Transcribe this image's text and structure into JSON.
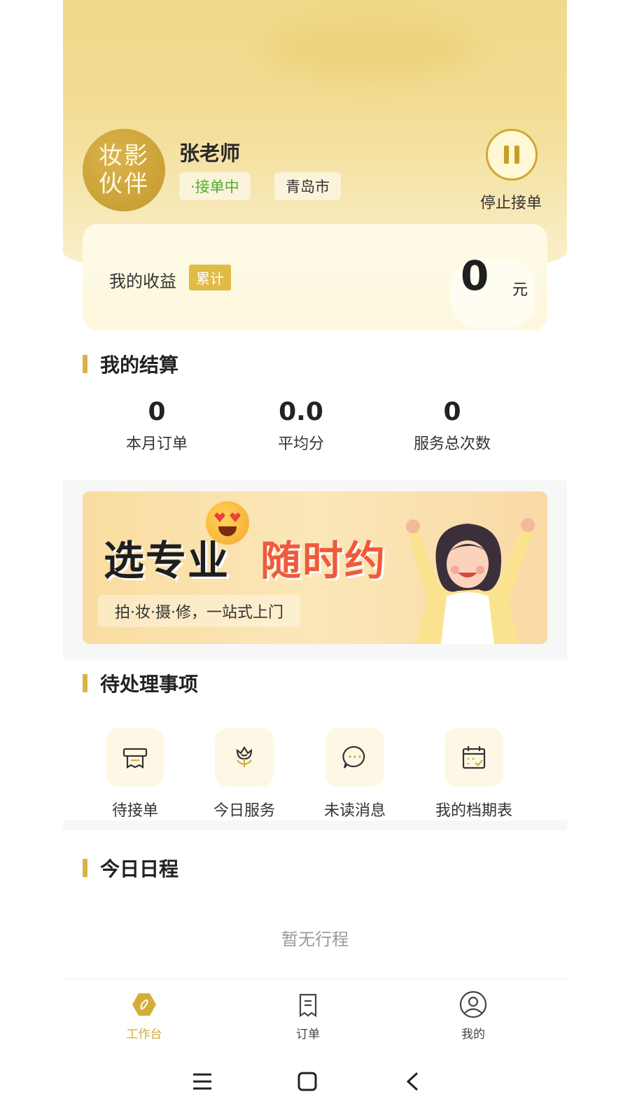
{
  "profile": {
    "logo_text_line1": "妆影",
    "logo_text_line2": "伙伴",
    "name": "张老师",
    "status": "·接单中",
    "city": "青岛市",
    "stop_label": "停止接单"
  },
  "earnings": {
    "label": "我的收益",
    "badge": "累计",
    "value": "0",
    "unit": "元"
  },
  "settlement": {
    "title": "我的结算",
    "stats": [
      {
        "value": "0",
        "label": "本月订单"
      },
      {
        "value": "0.0",
        "label": "平均分"
      },
      {
        "value": "0",
        "label": "服务总次数"
      }
    ]
  },
  "banner": {
    "title_part1": "选专业",
    "title_part2": "随时约",
    "subtitle": "拍·妆·摄·修，一站式上门"
  },
  "pending": {
    "title": "待处理事项",
    "items": [
      {
        "label": "待接单",
        "icon": "receipt-icon"
      },
      {
        "label": "今日服务",
        "icon": "flower-icon"
      },
      {
        "label": "未读消息",
        "icon": "chat-icon"
      },
      {
        "label": "我的档期表",
        "icon": "calendar-icon"
      }
    ]
  },
  "schedule": {
    "title": "今日日程",
    "empty_text": "暂无行程"
  },
  "tabbar": {
    "items": [
      {
        "label": "工作台",
        "icon": "workbench-icon",
        "active": true
      },
      {
        "label": "订单",
        "icon": "order-icon",
        "active": false
      },
      {
        "label": "我的",
        "icon": "profile-icon",
        "active": false
      }
    ]
  },
  "system_nav": [
    "menu-icon",
    "home-icon",
    "back-icon"
  ],
  "colors": {
    "accent": "#d4ac3a",
    "status_green": "#4caf2c",
    "banner_red": "#ef5a3d"
  }
}
